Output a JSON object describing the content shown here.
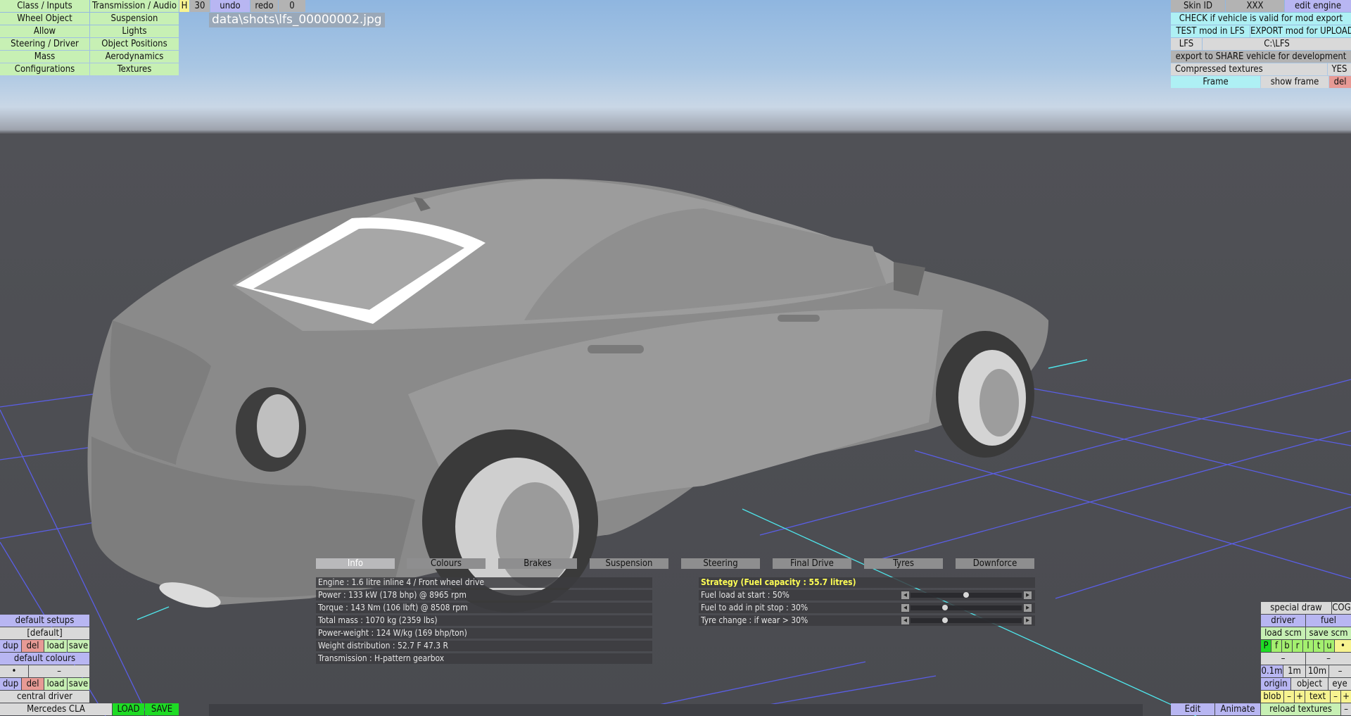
{
  "top_left_menu": {
    "class_inputs": "Class / Inputs",
    "transmission_audio": "Transmission / Audio",
    "h": "H",
    "thirty": "30",
    "undo": "undo",
    "redo": "redo",
    "zero": "0",
    "wheel_object": "Wheel Object",
    "suspension": "Suspension",
    "allow": "Allow",
    "lights": "Lights",
    "steering_driver": "Steering / Driver",
    "object_positions": "Object Positions",
    "mass": "Mass",
    "aerodynamics": "Aerodynamics",
    "configurations": "Configurations",
    "textures": "Textures"
  },
  "file_path": "data\\shots\\lfs_00000002.jpg",
  "top_right_menu": {
    "skin_id": "Skin ID",
    "xxx": "XXX",
    "edit_engine": "edit engine",
    "check_valid": "CHECK if vehicle is valid for mod export",
    "test_mod": "TEST mod in LFS",
    "export_mod": "EXPORT mod for UPLOAD",
    "lfs": "LFS",
    "lfs_path": "C:\\LFS",
    "export_share": "export to SHARE vehicle for development",
    "compressed_textures": "Compressed textures",
    "yes": "YES",
    "frame": "Frame",
    "show_frame": "show frame",
    "del": "del"
  },
  "tabs": [
    "Info",
    "Colours",
    "Brakes",
    "Suspension",
    "Steering",
    "Final Drive",
    "Tyres",
    "Downforce"
  ],
  "info_rows": [
    "Engine : 1.6 litre inline 4 / Front wheel drive",
    "Power : 133 kW (178 bhp) @ 8965 rpm",
    "Torque : 143 Nm (106 lbft) @ 8508 rpm",
    "Total mass : 1070 kg (2359 lbs)",
    "Power-weight : 124 W/kg (169 bhp/ton)",
    "Weight distribution : 52.7 F  47.3 R",
    "Transmission : H-pattern gearbox"
  ],
  "strategy": {
    "title": "Strategy (Fuel capacity : 55.7 litres)",
    "rows": [
      {
        "label": "Fuel load at start : 50%",
        "value": 0.5
      },
      {
        "label": "Fuel to add in pit stop : 30%",
        "value": 0.3
      },
      {
        "label": "Tyre change : if wear > 30%",
        "value": 0.3
      }
    ]
  },
  "bottom_left": {
    "default_setups": "default setups",
    "default_bracket": "[default]",
    "dup": "dup",
    "del": "del",
    "load": "load",
    "save": "save",
    "default_colours": "default colours",
    "dot": "•",
    "dash": "–",
    "central_driver": "central driver",
    "car_name": "Mercedes CLA",
    "load_caps": "LOAD",
    "save_caps": "SAVE"
  },
  "bottom_right": {
    "special_draw": "special draw",
    "cog": "COG",
    "driver": "driver",
    "fuel": "fuel",
    "load_scm": "load scm",
    "save_scm": "save scm",
    "letters": [
      "P",
      "f",
      "b",
      "r",
      "l",
      "t",
      "u"
    ],
    "dot": "•",
    "dash": "–",
    "steps": [
      "0.1m",
      "1m",
      "10m",
      "–"
    ],
    "origin": "origin",
    "object": "object",
    "eye": "eye",
    "blob": "blob",
    "minus": "–",
    "plus": "+",
    "text": "text",
    "edit": "Edit",
    "animate": "Animate",
    "reload_textures": "reload textures"
  }
}
